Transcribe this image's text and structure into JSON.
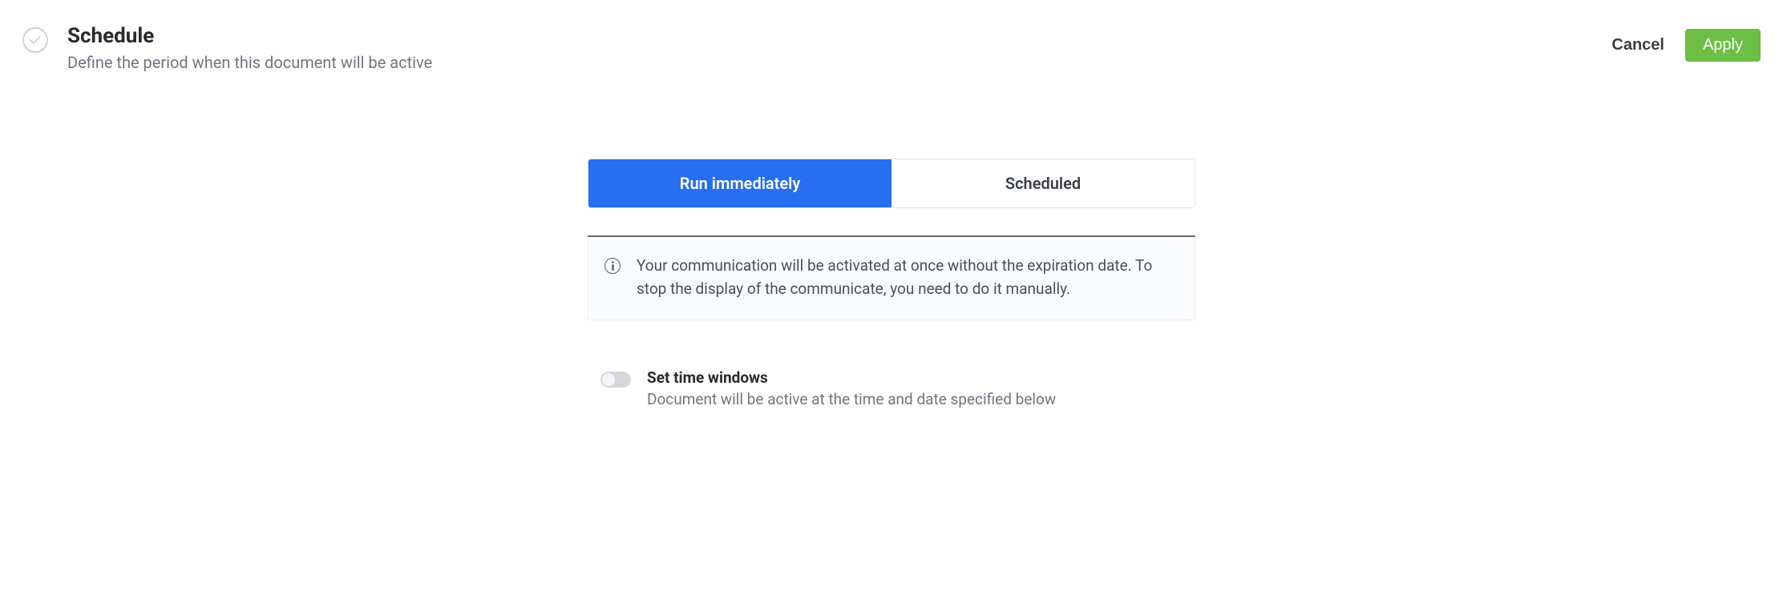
{
  "header": {
    "title": "Schedule",
    "subtitle": "Define the period when this document will be active",
    "cancel_label": "Cancel",
    "apply_label": "Apply"
  },
  "tabs": {
    "run_immediately": "Run immediately",
    "scheduled": "Scheduled"
  },
  "info": {
    "text": "Your communication will be activated at once without the expiration date. To stop the display of the communicate, you need to do it manually."
  },
  "toggle": {
    "title": "Set time windows",
    "subtitle": "Document will be active at the time and date specified below"
  }
}
